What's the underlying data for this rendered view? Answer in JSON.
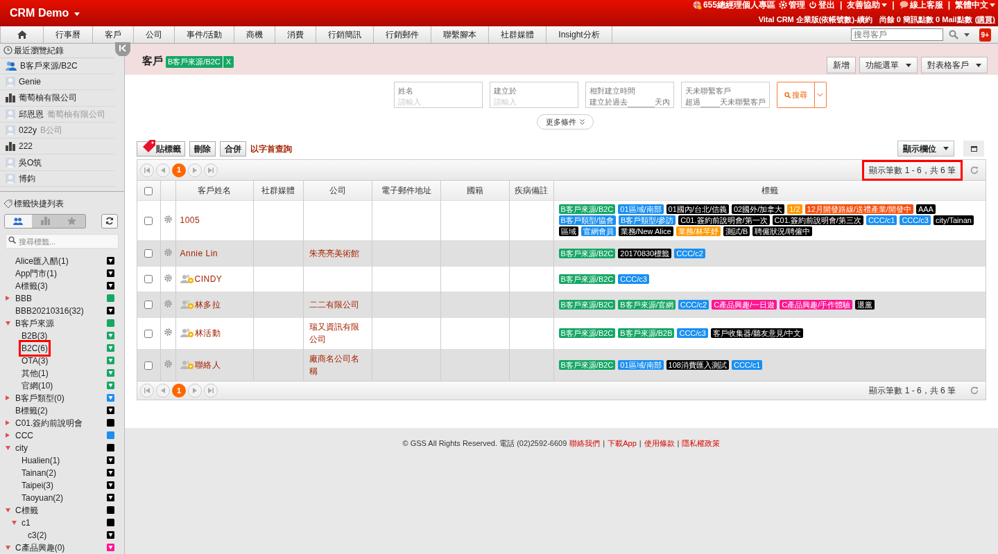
{
  "header": {
    "app_title": "CRM Demo",
    "top_links": [
      {
        "kind": "globe",
        "text": "655總經理個人專區"
      },
      {
        "kind": "gear",
        "text": "管理"
      },
      {
        "kind": "power",
        "text": "登出"
      },
      {
        "kind": "sep",
        "text": "|"
      },
      {
        "kind": "menu",
        "text": "友善協助"
      },
      {
        "kind": "sep",
        "text": "|"
      },
      {
        "kind": "chat",
        "text": "線上客服"
      },
      {
        "kind": "sep",
        "text": "|"
      },
      {
        "kind": "menu",
        "text": "繁體中文"
      }
    ],
    "plan": "Vital CRM 企業版(依帳號數)-續約",
    "points": "尚餘 0 簡訊點數 0 Mail點數",
    "buy_link": "(購買)"
  },
  "nav": {
    "items": [
      "行事曆",
      "客戶",
      "公司",
      "事件/活動",
      "商機",
      "消費",
      "行銷簡訊",
      "行銷郵件",
      "聯繫腳本",
      "社群媒體",
      "Insight分析"
    ],
    "search_placeholder": "搜尋客戶",
    "badge": "9+"
  },
  "sidebar": {
    "recent_title": "最近瀏覽紀錄",
    "recent": [
      {
        "kind": "group",
        "name": "B客戶來源/B2C"
      },
      {
        "kind": "person",
        "name": "Genie"
      },
      {
        "kind": "company",
        "name": "葡萄柚有限公司"
      },
      {
        "kind": "person",
        "name": "邱恩恩",
        "sub": "葡萄柚有限公司"
      },
      {
        "kind": "person",
        "name": "022y",
        "sub": "B公司"
      },
      {
        "kind": "company",
        "name": "222"
      },
      {
        "kind": "person",
        "name": "吳O筑"
      },
      {
        "kind": "person",
        "name": "博鈞"
      }
    ],
    "tags_title": "標籤快捷列表",
    "tag_tabs": [
      {
        "kind": "people",
        "selected": true
      },
      {
        "kind": "company",
        "selected": false
      },
      {
        "kind": "star",
        "selected": false
      }
    ],
    "tag_search_placeholder": "搜尋標籤...",
    "tags": [
      {
        "label": "Alice匯入醋(1)",
        "kind": "filter",
        "color": "#000000",
        "selected": false
      },
      {
        "label": "App門市(1)",
        "kind": "filter",
        "color": "#000000",
        "selected": false
      },
      {
        "label": "A標籤(3)",
        "kind": "filter",
        "color": "#000000",
        "selected": false
      },
      {
        "label": "BBB",
        "kind": "solid",
        "color": "#16a765",
        "expanded": false,
        "selected": false
      },
      {
        "label": "BBB20210316(32)",
        "kind": "filter",
        "color": "#000000",
        "selected": false
      },
      {
        "label": "B客戶來源",
        "kind": "solid",
        "color": "#16a765",
        "expanded": true,
        "selected": false,
        "children": [
          {
            "label": "B2B(3)",
            "kind": "filter",
            "color": "#16a765",
            "selected": false
          },
          {
            "label": "B2C(6)",
            "kind": "filter",
            "color": "#16a765",
            "selected": true
          },
          {
            "label": "OTA(3)",
            "kind": "filter",
            "color": "#16a765",
            "selected": false
          },
          {
            "label": "其他(1)",
            "kind": "filter",
            "color": "#16a765",
            "selected": false
          },
          {
            "label": "官網(10)",
            "kind": "filter",
            "color": "#16a765",
            "selected": false
          }
        ]
      },
      {
        "label": "B客戶類型(0)",
        "kind": "filter",
        "color": "#1a8ff0",
        "expanded": false,
        "selected": false
      },
      {
        "label": "B標籤(2)",
        "kind": "filter",
        "color": "#000000",
        "selected": false
      },
      {
        "label": "C01.簽約前說明會",
        "kind": "solid",
        "color": "#000000",
        "expanded": false,
        "selected": false
      },
      {
        "label": "CCC",
        "kind": "solid",
        "color": "#1a8ff0",
        "expanded": false,
        "selected": false
      },
      {
        "label": "city",
        "kind": "solid",
        "color": "#000000",
        "expanded": true,
        "selected": false,
        "children": [
          {
            "label": "Hualien(1)",
            "kind": "filter",
            "color": "#000000",
            "selected": false
          },
          {
            "label": "Tainan(2)",
            "kind": "filter",
            "color": "#000000",
            "selected": false
          },
          {
            "label": "Taipei(3)",
            "kind": "filter",
            "color": "#000000",
            "selected": false
          },
          {
            "label": "Taoyuan(2)",
            "kind": "filter",
            "color": "#000000",
            "selected": false
          }
        ]
      },
      {
        "label": "C標籤",
        "kind": "solid",
        "color": "#000000",
        "expanded": true,
        "selected": false,
        "children": [
          {
            "label": "c1",
            "kind": "solid",
            "color": "#000000",
            "expanded": true,
            "selected": false,
            "children": [
              {
                "label": "c3(2)",
                "kind": "filter",
                "color": "#000000",
                "selected": false
              }
            ]
          }
        ]
      },
      {
        "label": "C產品興趣(0)",
        "kind": "filter",
        "color": "#ff1493",
        "expanded": true,
        "selected": false
      }
    ]
  },
  "page": {
    "title": "客戶",
    "filter_chip": "B客戶來源/B2C",
    "chip_close": "X",
    "actions": [
      {
        "label": "新增",
        "menu": false
      },
      {
        "label": "功能選單",
        "menu": true
      },
      {
        "label": "對表格客戶",
        "menu": true
      }
    ],
    "filters": [
      {
        "kind": "field",
        "label": "姓名",
        "placeholder": "請輸入"
      },
      {
        "kind": "field",
        "label": "建立於",
        "placeholder": "請輸入"
      },
      {
        "kind": "days",
        "label": "相對建立時間",
        "before": "建立於過去",
        "after": "天內"
      },
      {
        "kind": "days",
        "label": "天未聯繫客戶",
        "before": "超過",
        "after": "天未聯繫客戶"
      }
    ],
    "search_button": "搜尋",
    "more_filters": "更多條件",
    "toolbar": {
      "tag_button": "貼標籤",
      "delete_button": "刪除",
      "merge_button": "合併",
      "initial_link": "以字首查詢",
      "columns_button": "顯示欄位"
    },
    "pager": {
      "pages": [
        {
          "label": "1",
          "selected": true
        }
      ],
      "count": "顯示筆數 1 - 6，共 6 筆"
    },
    "table": {
      "select_all_checked": false,
      "columns": [
        "客戶姓名",
        "社群媒體",
        "公司",
        "電子郵件地址",
        "國籍",
        "疾病備註",
        "標籤"
      ],
      "rows": [
        {
          "kind": "customer",
          "checked": false,
          "name": "1005",
          "tags": [
            {
              "text": "B客戶來源/B2C",
              "color": "#16a765"
            },
            {
              "text": "01區域/南部",
              "color": "#1a8ff0"
            },
            {
              "text": "01國內/台北/信義",
              "color": "#000000"
            },
            {
              "text": "02國外/加拿大",
              "color": "#000000"
            },
            {
              "text": "1/2",
              "color": "#ff9900"
            },
            {
              "text": "12月開發路線/送禮產業/開發中",
              "color": "#f5500f"
            },
            {
              "text": "AAA",
              "color": "#000000"
            },
            {
              "text": "B客戶類型/協會",
              "color": "#1a8ff0"
            },
            {
              "text": "B客戶類型/參訪",
              "color": "#1a8ff0"
            },
            {
              "text": "C01.簽約前說明會/第一次",
              "color": "#000000"
            },
            {
              "text": "C01.簽約前說明會/第三次",
              "color": "#000000"
            },
            {
              "text": "CCC/c1",
              "color": "#1a8ff0"
            },
            {
              "text": "CCC/c3",
              "color": "#1a8ff0"
            },
            {
              "text": "city/Tainan",
              "color": "#000000"
            },
            {
              "text": "區域",
              "color": "#000000"
            },
            {
              "text": "官網會員",
              "color": "#1a8ff0"
            },
            {
              "text": "業務/New Alice",
              "color": "#000000"
            },
            {
              "text": "業務/林芊妤",
              "color": "#ff9900"
            },
            {
              "text": "測試/B",
              "color": "#000000"
            },
            {
              "text": "聘僱狀況/聘僱中",
              "color": "#000000"
            }
          ]
        },
        {
          "kind": "customer",
          "checked": false,
          "name": "Annie Lin",
          "company": "朱亮亮美術館",
          "tags": [
            {
              "text": "B客戶來源/B2C",
              "color": "#16a765"
            },
            {
              "text": "20170830標籤",
              "color": "#000000"
            },
            {
              "text": "CCC/c2",
              "color": "#1a8ff0"
            }
          ]
        },
        {
          "kind": "contact",
          "checked": false,
          "name": "CINDY",
          "tags": [
            {
              "text": "B客戶來源/B2C",
              "color": "#16a765"
            },
            {
              "text": "CCC/c3",
              "color": "#1a8ff0"
            }
          ]
        },
        {
          "kind": "contact",
          "checked": false,
          "name": "林多拉",
          "company": "二二有限公司",
          "tags": [
            {
              "text": "B客戶來源/B2C",
              "color": "#16a765"
            },
            {
              "text": "B客戶來源/官網",
              "color": "#16a765"
            },
            {
              "text": "CCC/c2",
              "color": "#1a8ff0"
            },
            {
              "text": "C產品興趣/一日遊",
              "color": "#ff1493"
            },
            {
              "text": "C產品興趣/手作體驗",
              "color": "#ff1493"
            },
            {
              "text": "退黨",
              "color": "#000000"
            }
          ]
        },
        {
          "kind": "contact",
          "checked": false,
          "name": "林活動",
          "company": "瑞又資訊有限公司",
          "tags": [
            {
              "text": "B客戶來源/B2C",
              "color": "#16a765"
            },
            {
              "text": "B客戶來源/B2B",
              "color": "#16a765"
            },
            {
              "text": "CCC/c3",
              "color": "#1a8ff0"
            },
            {
              "text": "客戶收集器/聽友意見/中文",
              "color": "#000000"
            }
          ]
        },
        {
          "kind": "contact",
          "checked": false,
          "name": "聯絡人",
          "company": "廠商名公司名稱",
          "tags": [
            {
              "text": "B客戶來源/B2C",
              "color": "#16a765"
            },
            {
              "text": "01區域/南部",
              "color": "#1a8ff0"
            },
            {
              "text": "108消費匯入測試",
              "color": "#000000"
            },
            {
              "text": "CCC/c1",
              "color": "#1a8ff0"
            }
          ]
        }
      ]
    },
    "bottom_pager": {
      "pages": [
        {
          "label": "1",
          "selected": true
        }
      ],
      "count": "顯示筆數 1 - 6，共 6 筆"
    }
  },
  "footer": {
    "copyright": "© GSS All Rights Reserved. 電話 (02)2592-6609",
    "links": [
      "聯絡我們",
      "下載App",
      "使用條款",
      "隱私權政策"
    ],
    "separator": "|"
  }
}
